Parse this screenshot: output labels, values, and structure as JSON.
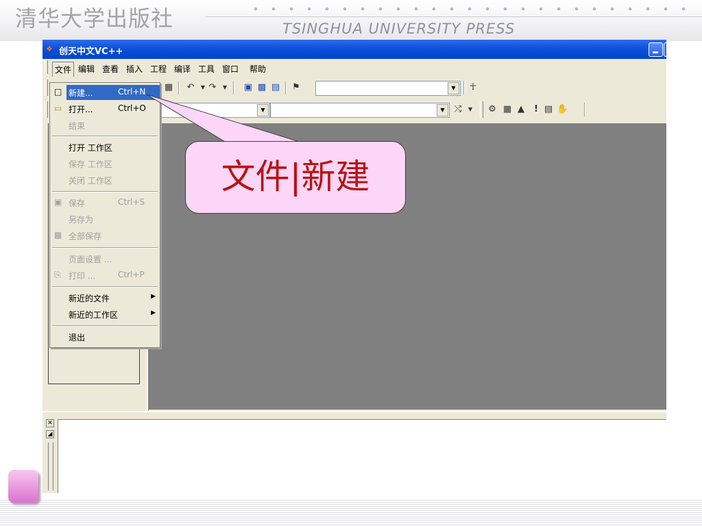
{
  "slide": {
    "publisher_cn": "清华大学出版社",
    "publisher_en": "TSINGHUA UNIVERSITY PRESS"
  },
  "window": {
    "title": "创天中文VC++",
    "title_icon": "app-logo-icon"
  },
  "menu": {
    "items": [
      "文件",
      "编辑",
      "查看",
      "插入",
      "工程",
      "编译",
      "工具",
      "窗口",
      "帮助"
    ]
  },
  "file_menu": {
    "items": [
      {
        "label": "新建...",
        "shortcut": "Ctrl+N",
        "icon": "new-file-icon"
      },
      {
        "label": "打开...",
        "shortcut": "Ctrl+O",
        "icon": "open-folder-icon"
      },
      {
        "label": "结束",
        "shortcut": ""
      },
      {
        "label": "打开 工作区",
        "shortcut": ""
      },
      {
        "label": "保存 工作区",
        "shortcut": ""
      },
      {
        "label": "关闭 工作区",
        "shortcut": ""
      },
      {
        "label": "保存",
        "shortcut": "Ctrl+S",
        "icon": "save-disk-icon"
      },
      {
        "label": "另存为",
        "shortcut": ""
      },
      {
        "label": "全部保存",
        "shortcut": "",
        "icon": "save-all-icon"
      },
      {
        "label": "页面设置 ...",
        "shortcut": ""
      },
      {
        "label": "打印 ...",
        "shortcut": "Ctrl+P",
        "icon": "printer-icon"
      },
      {
        "label": "新近的文件",
        "shortcut": ""
      },
      {
        "label": "新近的工作区",
        "shortcut": ""
      },
      {
        "label": "退出",
        "shortcut": ""
      }
    ]
  },
  "callout": {
    "text": "文件|新建"
  },
  "colors": {
    "titlebar": "#0a4fd8",
    "highlight": "#316ac5",
    "callout_fill": "#fbd6f7",
    "callout_text": "#b81414"
  }
}
